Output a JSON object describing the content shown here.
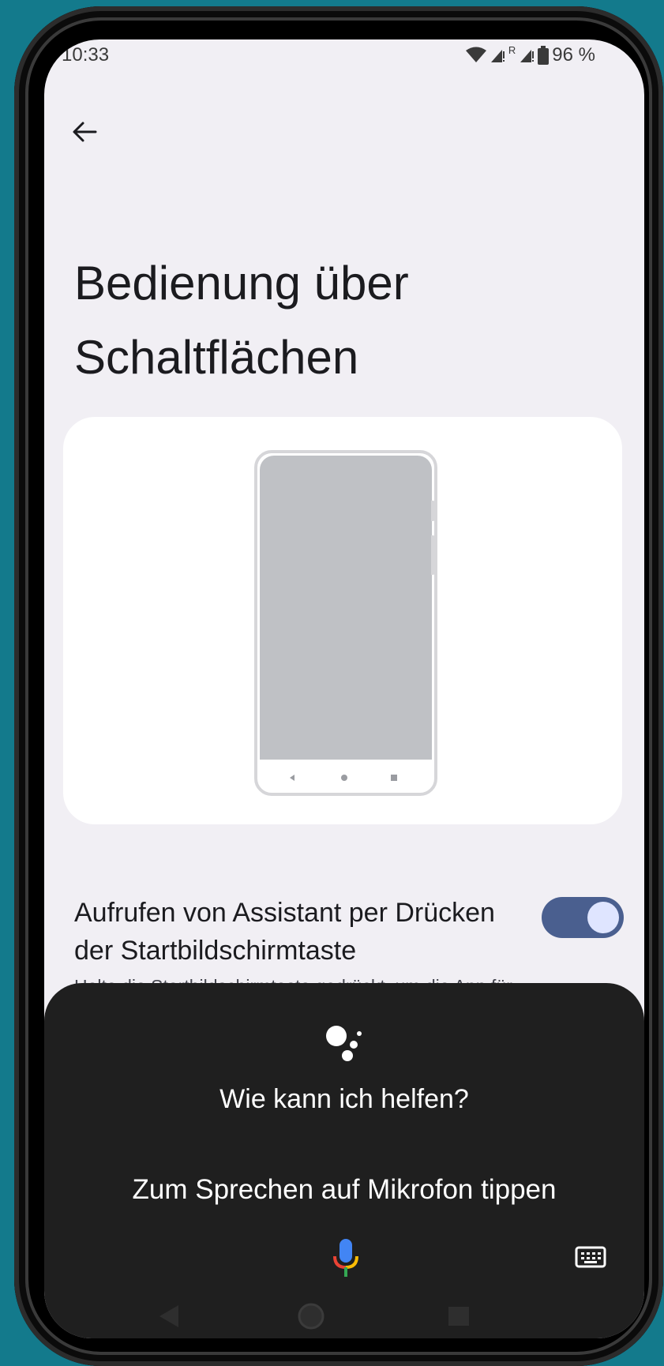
{
  "status_bar": {
    "time": "10:33",
    "battery": "96 %",
    "roaming_label": "R"
  },
  "header": {
    "back_icon": "arrow-left-icon",
    "title": "Bedienung über Schaltflächen"
  },
  "illustration": {
    "description_icons": [
      "back-triangle-icon",
      "home-circle-icon",
      "recents-square-icon"
    ]
  },
  "setting": {
    "title": "Aufrufen von Assistant per Drücken der Startbildschirmtaste",
    "subtitle": "Halte die Startbildschirmtaste gedrückt, um die App für den digitalen Assistenten aufzurufen.",
    "enabled": true
  },
  "assistant_sheet": {
    "prompt": "Wie kann ich helfen?",
    "hint": "Zum Sprechen auf Mikrofon tippen",
    "mic_icon": "microphone-icon",
    "keyboard_icon": "keyboard-icon"
  },
  "colors": {
    "switch_track": "#4a5f8f",
    "sheet_bg": "#1f1f1f",
    "page_bg": "#f1eff4"
  }
}
